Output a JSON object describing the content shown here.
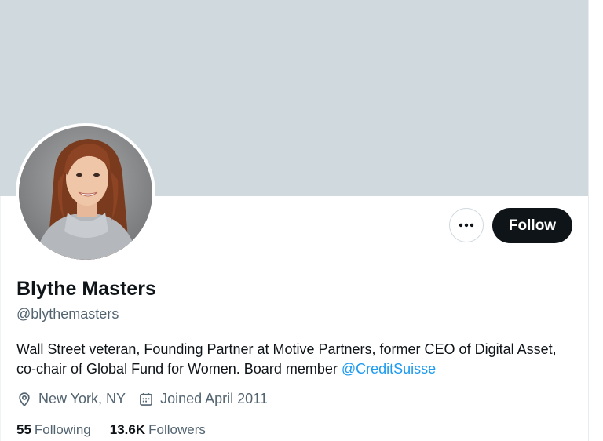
{
  "profile": {
    "name": "Blythe Masters",
    "handle": "@blythemasters",
    "bio_text": "Wall Street veteran, Founding Partner at Motive Partners, former CEO of Digital Asset, co-chair of Global Fund for Women. Board member ",
    "bio_mention": "@CreditSuisse",
    "location": "New York, NY",
    "joined": "Joined April 2011"
  },
  "actions": {
    "follow_label": "Follow",
    "more_icon": "more-dots-icon"
  },
  "stats": {
    "following_count": "55",
    "following_label": "Following",
    "followers_count": "13.6K",
    "followers_label": "Followers"
  },
  "colors": {
    "banner": "#cfd9de",
    "accent": "#1d9bf0",
    "button_bg": "#0f1419",
    "secondary_text": "#536471"
  }
}
